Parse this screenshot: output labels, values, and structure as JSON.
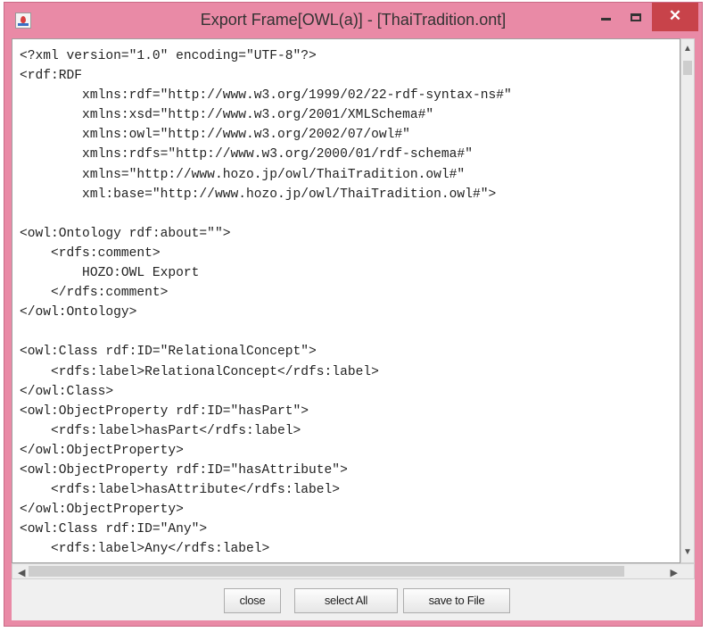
{
  "window": {
    "title": "Export Frame[OWL(a)] - [ThaiTradition.ont]",
    "close_glyph": "✕"
  },
  "editor": {
    "lines": [
      "<?xml version=\"1.0\" encoding=\"UTF-8\"?>",
      "<rdf:RDF",
      "        xmlns:rdf=\"http://www.w3.org/1999/02/22-rdf-syntax-ns#\"",
      "        xmlns:xsd=\"http://www.w3.org/2001/XMLSchema#\"",
      "        xmlns:owl=\"http://www.w3.org/2002/07/owl#\"",
      "        xmlns:rdfs=\"http://www.w3.org/2000/01/rdf-schema#\"",
      "        xmlns=\"http://www.hozo.jp/owl/ThaiTradition.owl#\"",
      "        xml:base=\"http://www.hozo.jp/owl/ThaiTradition.owl#\">",
      "",
      "<owl:Ontology rdf:about=\"\">",
      "    <rdfs:comment>",
      "        HOZO:OWL Export",
      "    </rdfs:comment>",
      "</owl:Ontology>",
      "",
      "<owl:Class rdf:ID=\"RelationalConcept\">",
      "    <rdfs:label>RelationalConcept</rdfs:label>",
      "</owl:Class>",
      "<owl:ObjectProperty rdf:ID=\"hasPart\">",
      "    <rdfs:label>hasPart</rdfs:label>",
      "</owl:ObjectProperty>",
      "<owl:ObjectProperty rdf:ID=\"hasAttribute\">",
      "    <rdfs:label>hasAttribute</rdfs:label>",
      "</owl:ObjectProperty>",
      "<owl:Class rdf:ID=\"Any\">",
      "    <rdfs:label>Any</rdfs:label>"
    ]
  },
  "buttons": {
    "close": "close",
    "select_all": "select All",
    "save_to_file": "save to File"
  },
  "icons": {
    "app": "java-cup-icon",
    "minimize": "minimize-icon",
    "maximize": "maximize-icon",
    "close": "close-icon"
  },
  "colors": {
    "titlebar": "#e98aa6",
    "close_button": "#c8434a"
  }
}
